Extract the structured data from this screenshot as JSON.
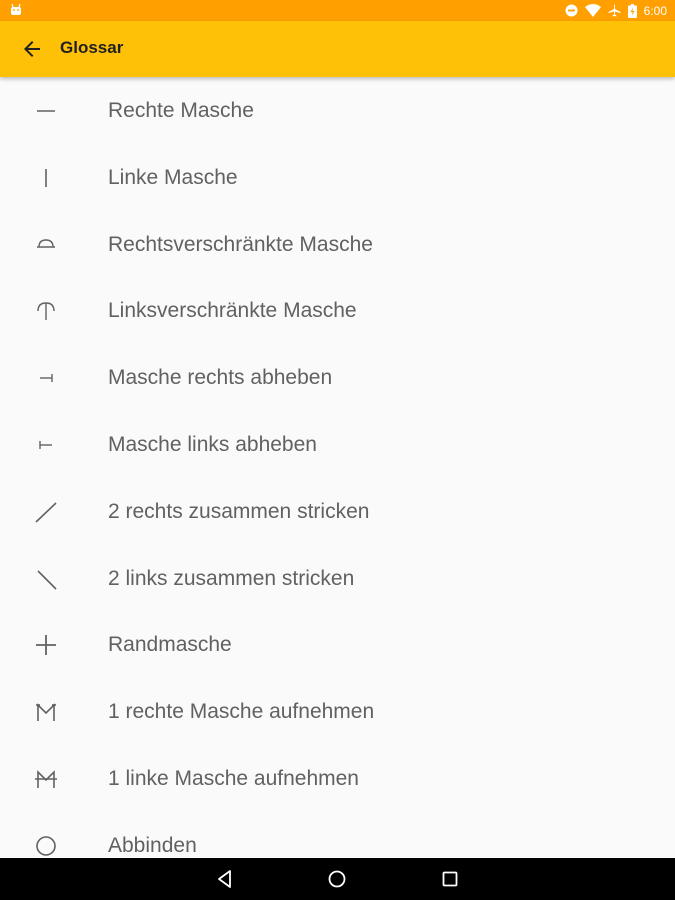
{
  "status_bar": {
    "time": "6:00",
    "left_icon": "android-notification-icon",
    "right_icons": [
      "do-not-disturb-icon",
      "wifi-icon",
      "airplane-icon",
      "battery-icon"
    ]
  },
  "app_bar": {
    "title": "Glossar",
    "back_icon": "arrow-back-icon",
    "color": "#ffc107"
  },
  "glossary": {
    "items": [
      {
        "symbol": "knit-stitch-symbol",
        "label": "Rechte Masche"
      },
      {
        "symbol": "purl-stitch-symbol",
        "label": "Linke Masche"
      },
      {
        "symbol": "twisted-knit-symbol",
        "label": "Rechtsverschränkte Masche"
      },
      {
        "symbol": "twisted-purl-symbol",
        "label": "Linksverschränkte Masche"
      },
      {
        "symbol": "slip-knitwise-symbol",
        "label": "Masche rechts abheben"
      },
      {
        "symbol": "slip-purlwise-symbol",
        "label": "Masche links abheben"
      },
      {
        "symbol": "k2tog-symbol",
        "label": "2 rechts zusammen stricken"
      },
      {
        "symbol": "p2tog-symbol",
        "label": "2 links zusammen stricken"
      },
      {
        "symbol": "edge-stitch-symbol",
        "label": "Randmasche"
      },
      {
        "symbol": "make-one-knit-symbol",
        "label": "1 rechte Masche aufnehmen"
      },
      {
        "symbol": "make-one-purl-symbol",
        "label": "1 linke Masche aufnehmen"
      },
      {
        "symbol": "bind-off-symbol",
        "label": "Abbinden"
      }
    ]
  },
  "nav_bar": {
    "icons": [
      "back-triangle-icon",
      "home-circle-icon",
      "recents-square-icon"
    ]
  }
}
